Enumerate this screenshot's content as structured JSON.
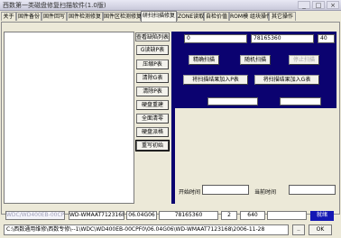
{
  "window": {
    "title": "西数第一类磁盘修复扫描软件(1.0版)",
    "controls": [
      "_",
      "□",
      "×"
    ]
  },
  "tabs": [
    {
      "label": "关于",
      "active": false
    },
    {
      "label": "固件备份",
      "active": false
    },
    {
      "label": "固件回写",
      "active": false
    },
    {
      "label": "固件检测修复",
      "active": false
    },
    {
      "label": "固件区检测修复",
      "active": false
    },
    {
      "label": "研扫扫描修复",
      "active": true
    },
    {
      "label": "ZONE读取",
      "active": false
    },
    {
      "label": "自检价值",
      "active": false
    },
    {
      "label": "ROM模 组块操作",
      "active": false
    },
    {
      "label": "其它操作",
      "active": false
    }
  ],
  "left_panel": {
    "header": "查看缺陷列表",
    "buttons": [
      "G读缺P表",
      "压缩P表",
      "清除G表",
      "清除P表",
      "硬盘重建",
      "全面清零",
      "硬盘派格",
      "重写初始"
    ]
  },
  "right_panel": {
    "start_lba": "0",
    "end_lba": "78165360",
    "step": "40",
    "buttons": {
      "linear_scan": "精确扫描",
      "random_scan": "随机扫描",
      "stop_scan": "停止扫描",
      "add_to_p": "将扫描结果加入P表",
      "add_to_g": "将扫描结果加入G表"
    },
    "start_time_label": "开始时间",
    "current_time_label": "当前时间"
  },
  "status": {
    "bus": "WDC/WD400EB-00CPF0",
    "model": "WD-WMAAT7123168",
    "firmware": "06.04G06",
    "capacity": "78165360",
    "heads": "2",
    "zone": "640",
    "result": "就绪"
  },
  "path": {
    "value": "C:\\西数通用维修\\西数专修\\--1\\WDC\\WD400EB-00CPF0\\06.04G06\\WD-WMAAT7123168\\2006-11-28",
    "browse_label": "..",
    "go_label": "OK"
  },
  "colors": {
    "panel_blue": "#0b0270",
    "badge_blue": "#1418b4"
  }
}
